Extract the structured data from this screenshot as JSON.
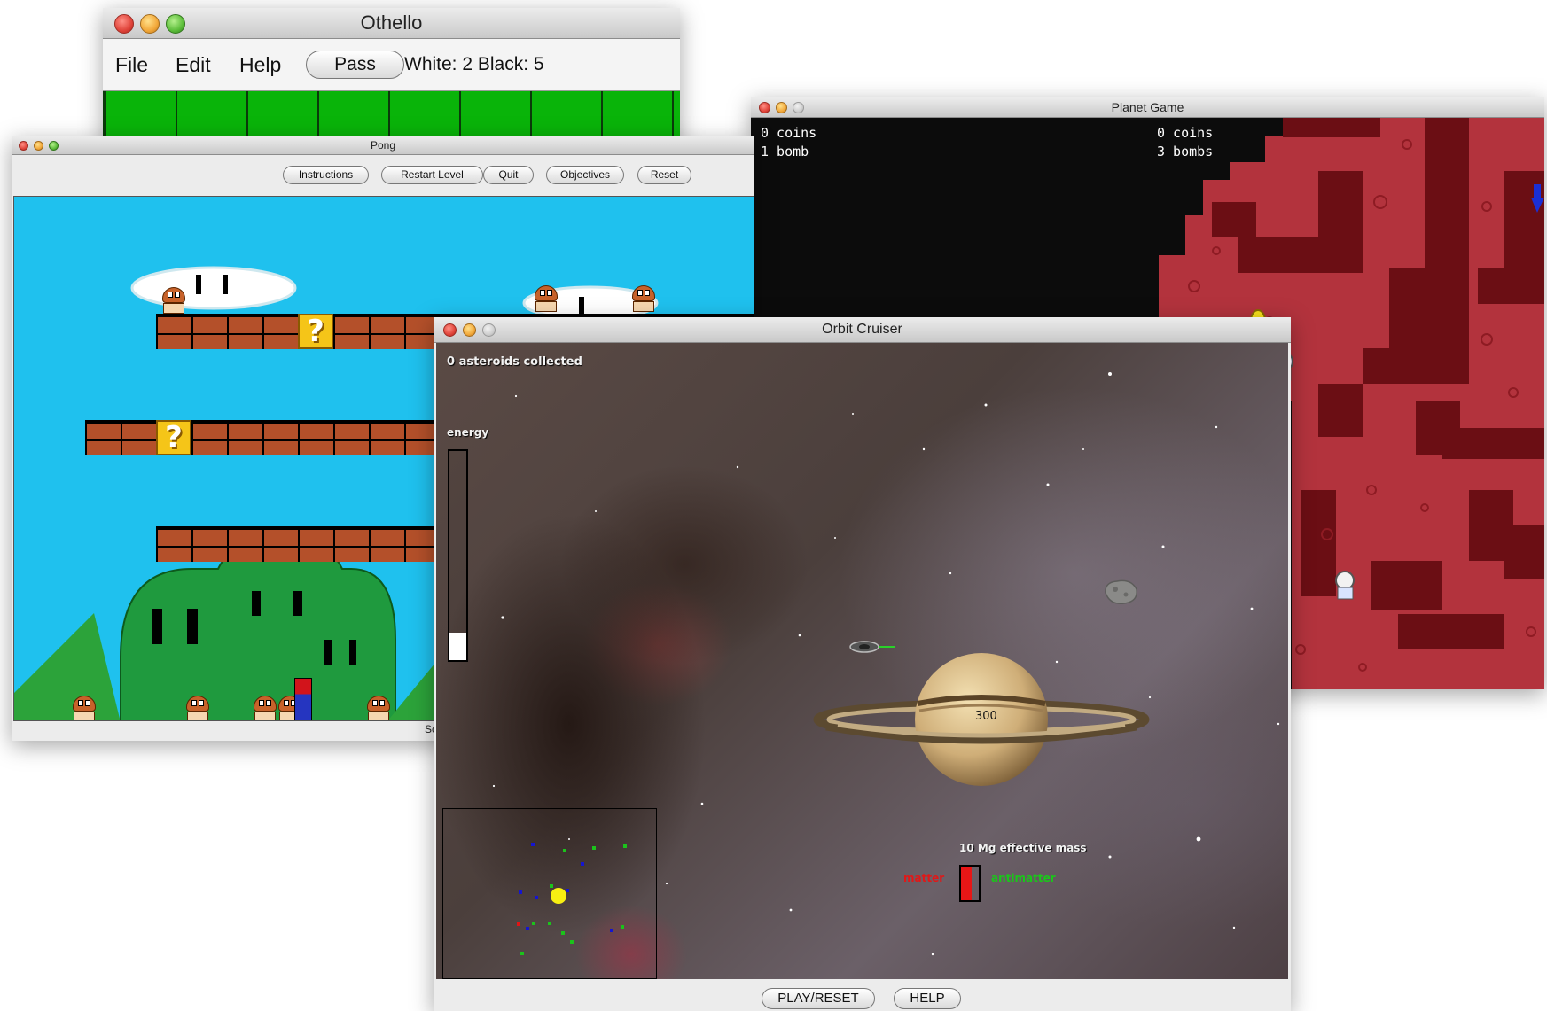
{
  "othello": {
    "title": "Othello",
    "menu": [
      "File",
      "Edit",
      "Help"
    ],
    "pass_label": "Pass",
    "score_text": "White: 2 Black: 5",
    "board_color": "#09b409"
  },
  "pong": {
    "title": "Pong",
    "buttons": [
      "Instructions",
      "Restart Level",
      "Quit",
      "Objectives",
      "Reset"
    ],
    "sky_color": "#1fc1ee",
    "blocks": [
      "?",
      "?"
    ],
    "footer_text": "Sc"
  },
  "planet": {
    "title": "Planet Game",
    "left": {
      "coins": "0 coins",
      "bombs": "1 bomb"
    },
    "right": {
      "coins": "0 coins",
      "bombs": "3 bombs"
    },
    "terrain_color": "#b3333d"
  },
  "orbit": {
    "title": "Orbit Cruiser",
    "asteroids_text": "0 asteroids collected",
    "energy_label": "energy",
    "energy_level": 0.13,
    "planet_value": "300",
    "mass_text": "10 Mg effective mass",
    "matter_label": "matter",
    "antimatter_label": "antimatter",
    "play_label": "PLAY/RESET",
    "help_label": "HELP"
  }
}
